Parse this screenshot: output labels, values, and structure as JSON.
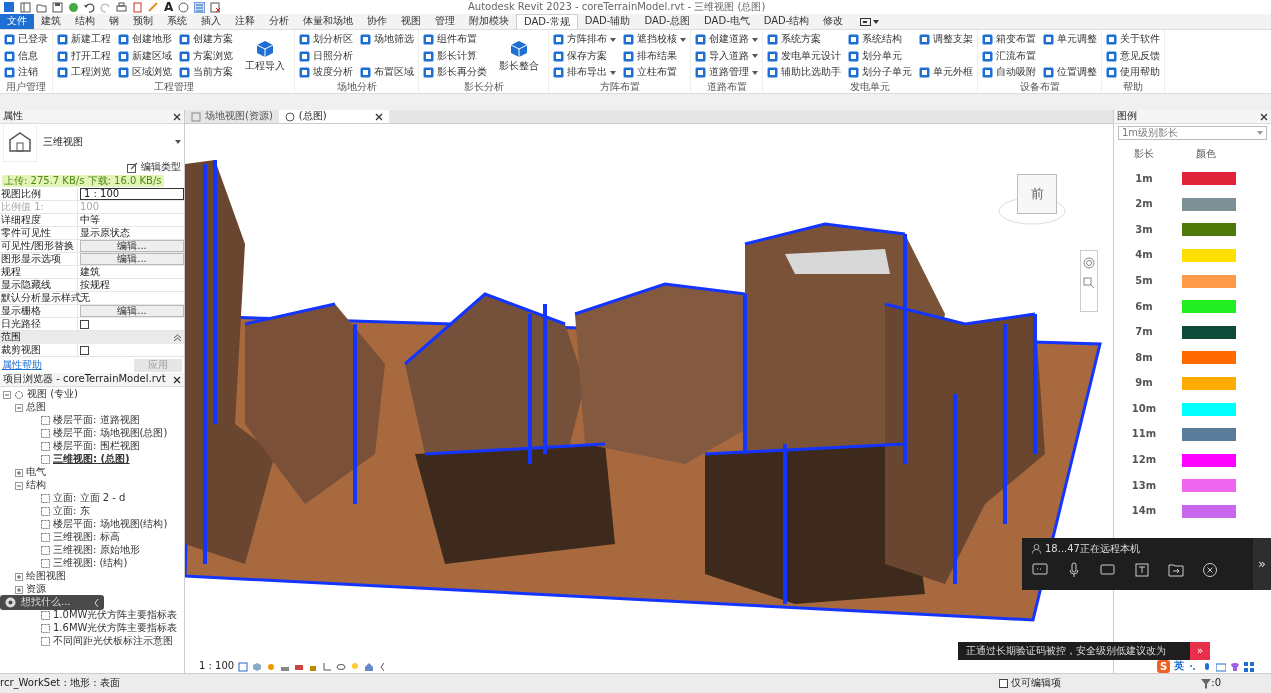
{
  "window": {
    "title": "Autodesk Revit 2023 - coreTerrainModel.rvt - 三维视图 (总图)",
    "quick_access_glyph": "A"
  },
  "ribbon_tabs": [
    {
      "label": "文件",
      "kind": "file",
      "selected": false
    },
    {
      "label": "建筑",
      "kind": "tab",
      "selected": false
    },
    {
      "label": "结构",
      "kind": "tab",
      "selected": false
    },
    {
      "label": "钢",
      "kind": "tab",
      "selected": false
    },
    {
      "label": "预制",
      "kind": "tab",
      "selected": false
    },
    {
      "label": "系统",
      "kind": "tab",
      "selected": false
    },
    {
      "label": "插入",
      "kind": "tab",
      "selected": false
    },
    {
      "label": "注释",
      "kind": "tab",
      "selected": false
    },
    {
      "label": "分析",
      "kind": "tab",
      "selected": false
    },
    {
      "label": "体量和场地",
      "kind": "tab",
      "selected": false
    },
    {
      "label": "协作",
      "kind": "tab",
      "selected": false
    },
    {
      "label": "视图",
      "kind": "tab",
      "selected": false
    },
    {
      "label": "管理",
      "kind": "tab",
      "selected": false
    },
    {
      "label": "附加模块",
      "kind": "tab",
      "selected": false
    },
    {
      "label": "DAD-常规",
      "kind": "tab",
      "selected": true
    },
    {
      "label": "DAD-辅助",
      "kind": "tab",
      "selected": false
    },
    {
      "label": "DAD-总图",
      "kind": "tab",
      "selected": false
    },
    {
      "label": "DAD-电气",
      "kind": "tab",
      "selected": false
    },
    {
      "label": "DAD-结构",
      "kind": "tab",
      "selected": false
    },
    {
      "label": "修改",
      "kind": "tab",
      "selected": false
    }
  ],
  "ribbon_panels": [
    {
      "label": "用户管理",
      "columns": [
        {
          "kind": "small",
          "items": [
            {
              "label": "已登录",
              "menu": false
            },
            {
              "label": "信息",
              "menu": false
            },
            {
              "label": "注销",
              "menu": false
            }
          ]
        }
      ]
    },
    {
      "label": "工程管理",
      "columns": [
        {
          "kind": "small",
          "items": [
            {
              "label": "新建工程",
              "menu": false
            },
            {
              "label": "打开工程",
              "menu": false
            },
            {
              "label": "工程浏览",
              "menu": false
            }
          ]
        },
        {
          "kind": "small",
          "items": [
            {
              "label": "创建地形",
              "menu": false
            },
            {
              "label": "新建区域",
              "menu": false
            },
            {
              "label": "区域浏览",
              "menu": false
            }
          ]
        },
        {
          "kind": "small",
          "items": [
            {
              "label": "创建方案",
              "menu": false
            },
            {
              "label": "方案浏览",
              "menu": false
            },
            {
              "label": "当前方案",
              "menu": false
            }
          ]
        },
        {
          "kind": "large",
          "items": [
            {
              "label": "工程导入",
              "menu": false
            }
          ]
        }
      ]
    },
    {
      "label": "场地分析",
      "columns": [
        {
          "kind": "small",
          "items": [
            {
              "label": "划分析区",
              "menu": false
            },
            {
              "label": "日照分析",
              "menu": false
            },
            {
              "label": "坡度分析",
              "menu": false
            }
          ]
        },
        {
          "kind": "small",
          "items": [
            {
              "label": "场地筛选",
              "menu": false
            },
            {
              "label": "布置区域",
              "menu": false
            }
          ]
        }
      ]
    },
    {
      "label": "影长分析",
      "columns": [
        {
          "kind": "small",
          "items": [
            {
              "label": "组件布置",
              "menu": false
            },
            {
              "label": "影长计算",
              "menu": false
            },
            {
              "label": "影长再分类",
              "menu": false
            }
          ]
        },
        {
          "kind": "large",
          "items": [
            {
              "label": "影长整合",
              "menu": false
            }
          ]
        }
      ]
    },
    {
      "label": "方阵布置",
      "columns": [
        {
          "kind": "small",
          "items": [
            {
              "label": "方阵排布",
              "menu": true
            },
            {
              "label": "保存方案",
              "menu": false
            },
            {
              "label": "排布导出",
              "menu": true
            }
          ]
        },
        {
          "kind": "small",
          "items": [
            {
              "label": "遮挡校核",
              "menu": true
            },
            {
              "label": "排布结果",
              "menu": false
            },
            {
              "label": "立柱布置",
              "menu": false
            }
          ]
        }
      ]
    },
    {
      "label": "道路布置",
      "columns": [
        {
          "kind": "small",
          "items": [
            {
              "label": "创建道路",
              "menu": true
            },
            {
              "label": "导入道路",
              "menu": true
            },
            {
              "label": "道路管理",
              "menu": true
            }
          ]
        }
      ]
    },
    {
      "label": "发电单元",
      "columns": [
        {
          "kind": "small",
          "items": [
            {
              "label": "系统方案",
              "menu": false
            },
            {
              "label": "发电单元设计",
              "menu": false
            },
            {
              "label": "辅助比选助手",
              "menu": false
            }
          ]
        },
        {
          "kind": "small",
          "items": [
            {
              "label": "系统结构",
              "menu": false
            },
            {
              "label": "划分单元",
              "menu": false
            },
            {
              "label": "划分子单元",
              "menu": false
            }
          ]
        },
        {
          "kind": "small",
          "items": [
            {
              "label": "调整支架",
              "menu": false
            },
            {
              "label": "单元外框",
              "menu": false
            }
          ]
        }
      ]
    },
    {
      "label": "设备布置",
      "columns": [
        {
          "kind": "small",
          "items": [
            {
              "label": "箱变布置",
              "menu": false
            },
            {
              "label": "汇流布置",
              "menu": false
            },
            {
              "label": "自动吸附",
              "menu": false
            }
          ]
        },
        {
          "kind": "small",
          "items": [
            {
              "label": "单元调整",
              "menu": false
            },
            {
              "label": "位置调整",
              "menu": false
            }
          ]
        }
      ]
    },
    {
      "label": "帮助",
      "columns": [
        {
          "kind": "small",
          "items": [
            {
              "label": "关于软件",
              "menu": false
            },
            {
              "label": "意见反馈",
              "menu": false
            },
            {
              "label": "使用帮助",
              "menu": false
            }
          ]
        }
      ]
    }
  ],
  "properties": {
    "title": "属性",
    "type_name": "三维视图",
    "network_speed": "上传: 275.7 KB/s 下载: 16.0 KB/s",
    "edit_type": "编辑类型",
    "rows": [
      {
        "kind": "input",
        "label": "视图比例",
        "value": "1 : 100"
      },
      {
        "kind": "disabled",
        "label": "比例值 1:",
        "value": "100"
      },
      {
        "kind": "text",
        "label": "详细程度",
        "value": "中等"
      },
      {
        "kind": "text",
        "label": "零件可见性",
        "value": "显示原状态"
      },
      {
        "kind": "button",
        "label": "可见性/图形替换",
        "value": "编辑..."
      },
      {
        "kind": "button",
        "label": "图形显示选项",
        "value": "编辑..."
      },
      {
        "kind": "text",
        "label": "规程",
        "value": "建筑"
      },
      {
        "kind": "text",
        "label": "显示隐藏线",
        "value": "按规程"
      },
      {
        "kind": "text",
        "label": "默认分析显示样式",
        "value": "无"
      },
      {
        "kind": "button",
        "label": "显示栅格",
        "value": "编辑..."
      },
      {
        "kind": "checkbox",
        "label": "日光路径",
        "checked": false
      },
      {
        "kind": "section",
        "label": "范围",
        "expanded": true
      },
      {
        "kind": "checkbox",
        "label": "裁剪视图",
        "checked": false
      }
    ],
    "help_link": "属性帮助",
    "apply": "应用"
  },
  "project_browser": {
    "title": "项目浏览器 - coreTerrainModel.rvt",
    "tree": [
      {
        "label": "视图 (专业)",
        "expanded": true,
        "selected": false,
        "children": [
          {
            "label": "总图",
            "expanded": true,
            "selected": false,
            "children": [
              {
                "label": "楼层平面: 道路视图",
                "selected": false
              },
              {
                "label": "楼层平面: 场地视图(总图)",
                "selected": false
              },
              {
                "label": "楼层平面: 围栏视图",
                "selected": false
              },
              {
                "label": "三维视图: (总图)",
                "selected": true
              }
            ]
          },
          {
            "label": "电气",
            "expanded": false,
            "selected": false
          },
          {
            "label": "结构",
            "expanded": true,
            "selected": false,
            "children": [
              {
                "label": "立面: 立面 2 - d",
                "selected": false
              },
              {
                "label": "立面: 东",
                "selected": false
              },
              {
                "label": "楼层平面: 场地视图(结构)",
                "selected": false
              },
              {
                "label": "三维视图: 标高",
                "selected": false
              },
              {
                "label": "三维视图: 原始地形",
                "selected": false
              },
              {
                "label": "三维视图: (结构)",
                "selected": false
              }
            ]
          },
          {
            "label": "绘图视图",
            "expanded": false,
            "selected": false
          },
          {
            "label": "资源",
            "expanded": false,
            "selected": false
          }
        ]
      }
    ],
    "search_pill": "想找什么...",
    "more_items": [
      {
        "label": "1.0MW光伏方阵主要指标表",
        "selected": false
      },
      {
        "label": "1.6MW光伏方阵主要指标表",
        "selected": false
      },
      {
        "label": "不同间距光伏板标注示意图",
        "selected": false
      }
    ]
  },
  "view_tabs": [
    {
      "label": "场地视图(资源)",
      "selected": false
    },
    {
      "label": "(总图)",
      "selected": true
    }
  ],
  "viewcube": {
    "face": "前"
  },
  "view_scale": "1 : 100",
  "legend": {
    "title": "图例",
    "selector": "1m级别影长",
    "col_length": "影长",
    "col_color": "颜色",
    "items": [
      {
        "label": "1m",
        "color": "#e0243a"
      },
      {
        "label": "2m",
        "color": "#7d9096"
      },
      {
        "label": "3m",
        "color": "#4f7a0a"
      },
      {
        "label": "4m",
        "color": "#ffdf00"
      },
      {
        "label": "5m",
        "color": "#ff9a48"
      },
      {
        "label": "6m",
        "color": "#22ee22"
      },
      {
        "label": "7m",
        "color": "#0d4a3a"
      },
      {
        "label": "8m",
        "color": "#ff6a00"
      },
      {
        "label": "9m",
        "color": "#ffab00"
      },
      {
        "label": "10m",
        "color": "#00ffff"
      },
      {
        "label": "11m",
        "color": "#5a7c9a"
      },
      {
        "label": "12m",
        "color": "#ff00ff"
      },
      {
        "label": "13m",
        "color": "#ee66ee"
      },
      {
        "label": "14m",
        "color": "#c966ee"
      }
    ]
  },
  "remote": {
    "status": "18...47正在远程本机",
    "expand": "»"
  },
  "notice": {
    "text": "正通过长期验证码被控，安全级别低建议改为",
    "more": "»"
  },
  "ime": {
    "logo": "S",
    "mode": "英"
  },
  "status_bar": {
    "selection": "rcr_WorkSet : 地形 : 表面",
    "editable_only": {
      "label": "仅可编辑项",
      "checked": false
    },
    "filter_count": ":0"
  }
}
